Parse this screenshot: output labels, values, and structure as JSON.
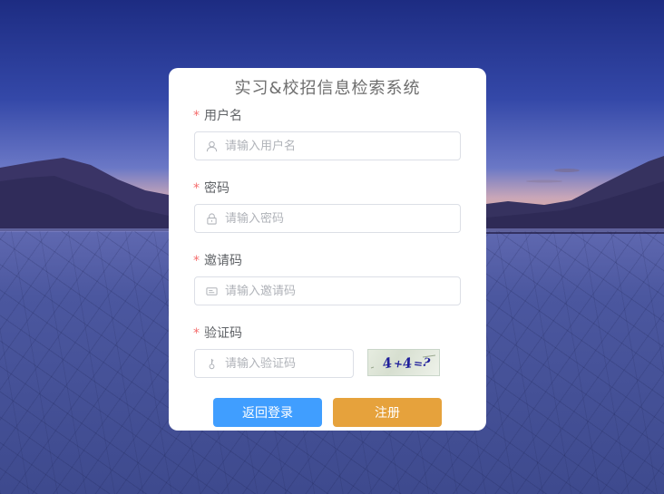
{
  "app": {
    "title": "实习&校招信息检索系统"
  },
  "form": {
    "username": {
      "label": "用户名",
      "required_mark": "*",
      "placeholder": "请输入用户名",
      "icon": "user-icon"
    },
    "password": {
      "label": "密码",
      "required_mark": "*",
      "placeholder": "请输入密码",
      "icon": "lock-icon"
    },
    "invite_code": {
      "label": "邀请码",
      "required_mark": "*",
      "placeholder": "请输入邀请码",
      "icon": "card-icon"
    },
    "captcha": {
      "label": "验证码",
      "required_mark": "*",
      "placeholder": "请输入验证码",
      "icon": "key-icon",
      "image_text": "4+4=?"
    }
  },
  "actions": {
    "back_label": "返回登录",
    "register_label": "注册"
  },
  "colors": {
    "primary": "#409eff",
    "warning": "#e6a23c",
    "required": "#f56c6c"
  }
}
